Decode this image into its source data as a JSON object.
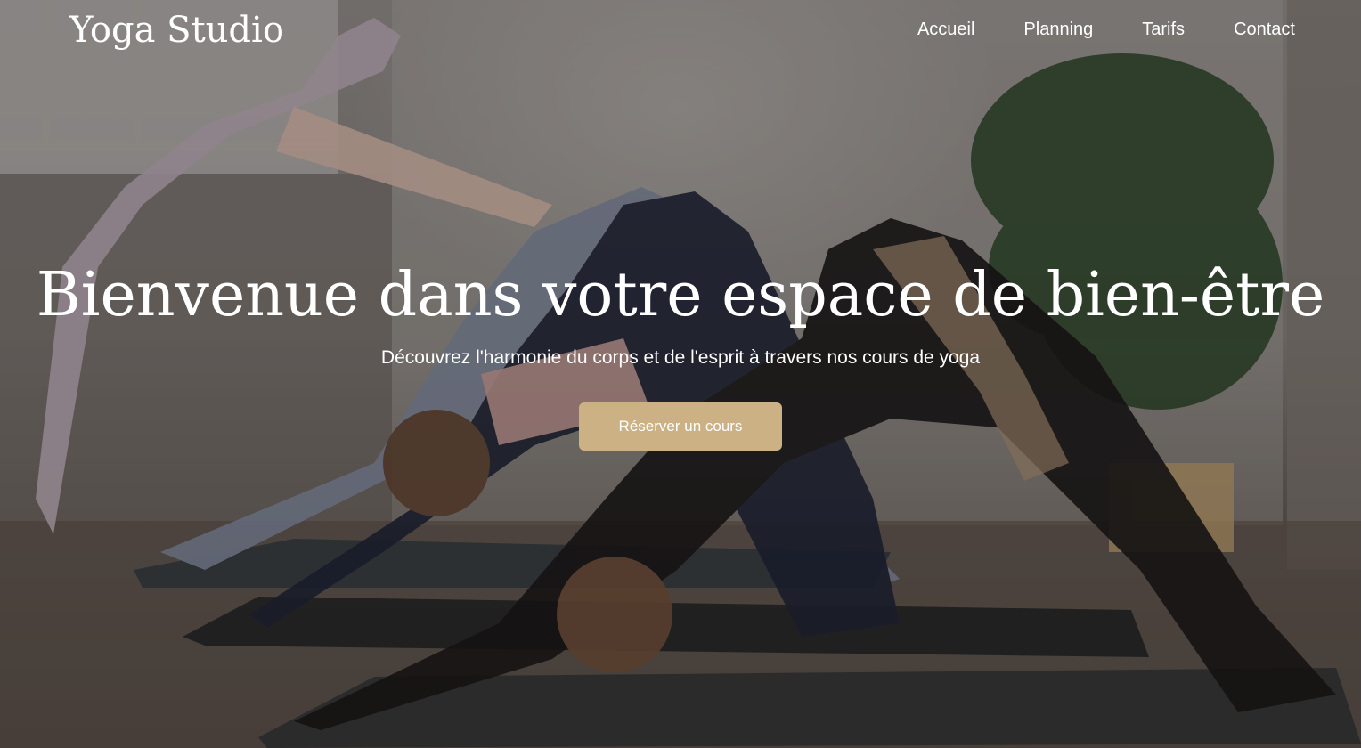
{
  "header": {
    "logo": "Yoga Studio",
    "nav": [
      {
        "label": "Accueil"
      },
      {
        "label": "Planning"
      },
      {
        "label": "Tarifs"
      },
      {
        "label": "Contact"
      }
    ]
  },
  "hero": {
    "title": "Bienvenue dans votre espace de bien-être",
    "subtitle": "Découvrez l'harmonie du corps et de l'esprit à travers nos cours de yoga",
    "cta_label": "Réserver un cours",
    "background_image": "yoga-class-photo"
  },
  "colors": {
    "accent": "#cbb184",
    "text": "#ffffff"
  }
}
